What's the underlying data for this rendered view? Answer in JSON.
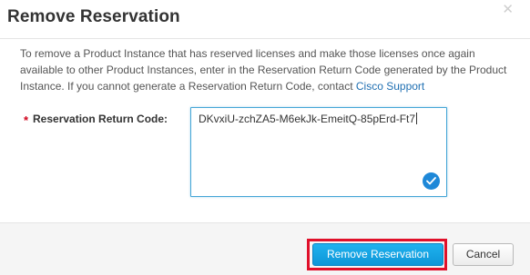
{
  "dialog": {
    "title": "Remove Reservation",
    "close_icon": "close-icon",
    "description": {
      "text": "To remove a Product Instance that has reserved licenses and make those licenses once again available to other Product Instances, enter in the Reservation Return Code generated by the Product Instance. If you cannot generate a Reservation Return Code, contact ",
      "link": "Cisco Support"
    },
    "field": {
      "required_marker": "*",
      "label": "Reservation Return Code:",
      "value": "DKvxiU-zchZA5-M6ekJk-EmeitQ-85pErd-Ft7",
      "valid_icon": "checkmark-icon"
    },
    "buttons": {
      "primary": "Remove Reservation",
      "cancel": "Cancel"
    }
  },
  "colors": {
    "primary_button": "#0e96d8",
    "link": "#1f6fb2",
    "required": "#d0021b",
    "highlight_box": "#e0102a",
    "valid_badge": "#1e88d8"
  }
}
